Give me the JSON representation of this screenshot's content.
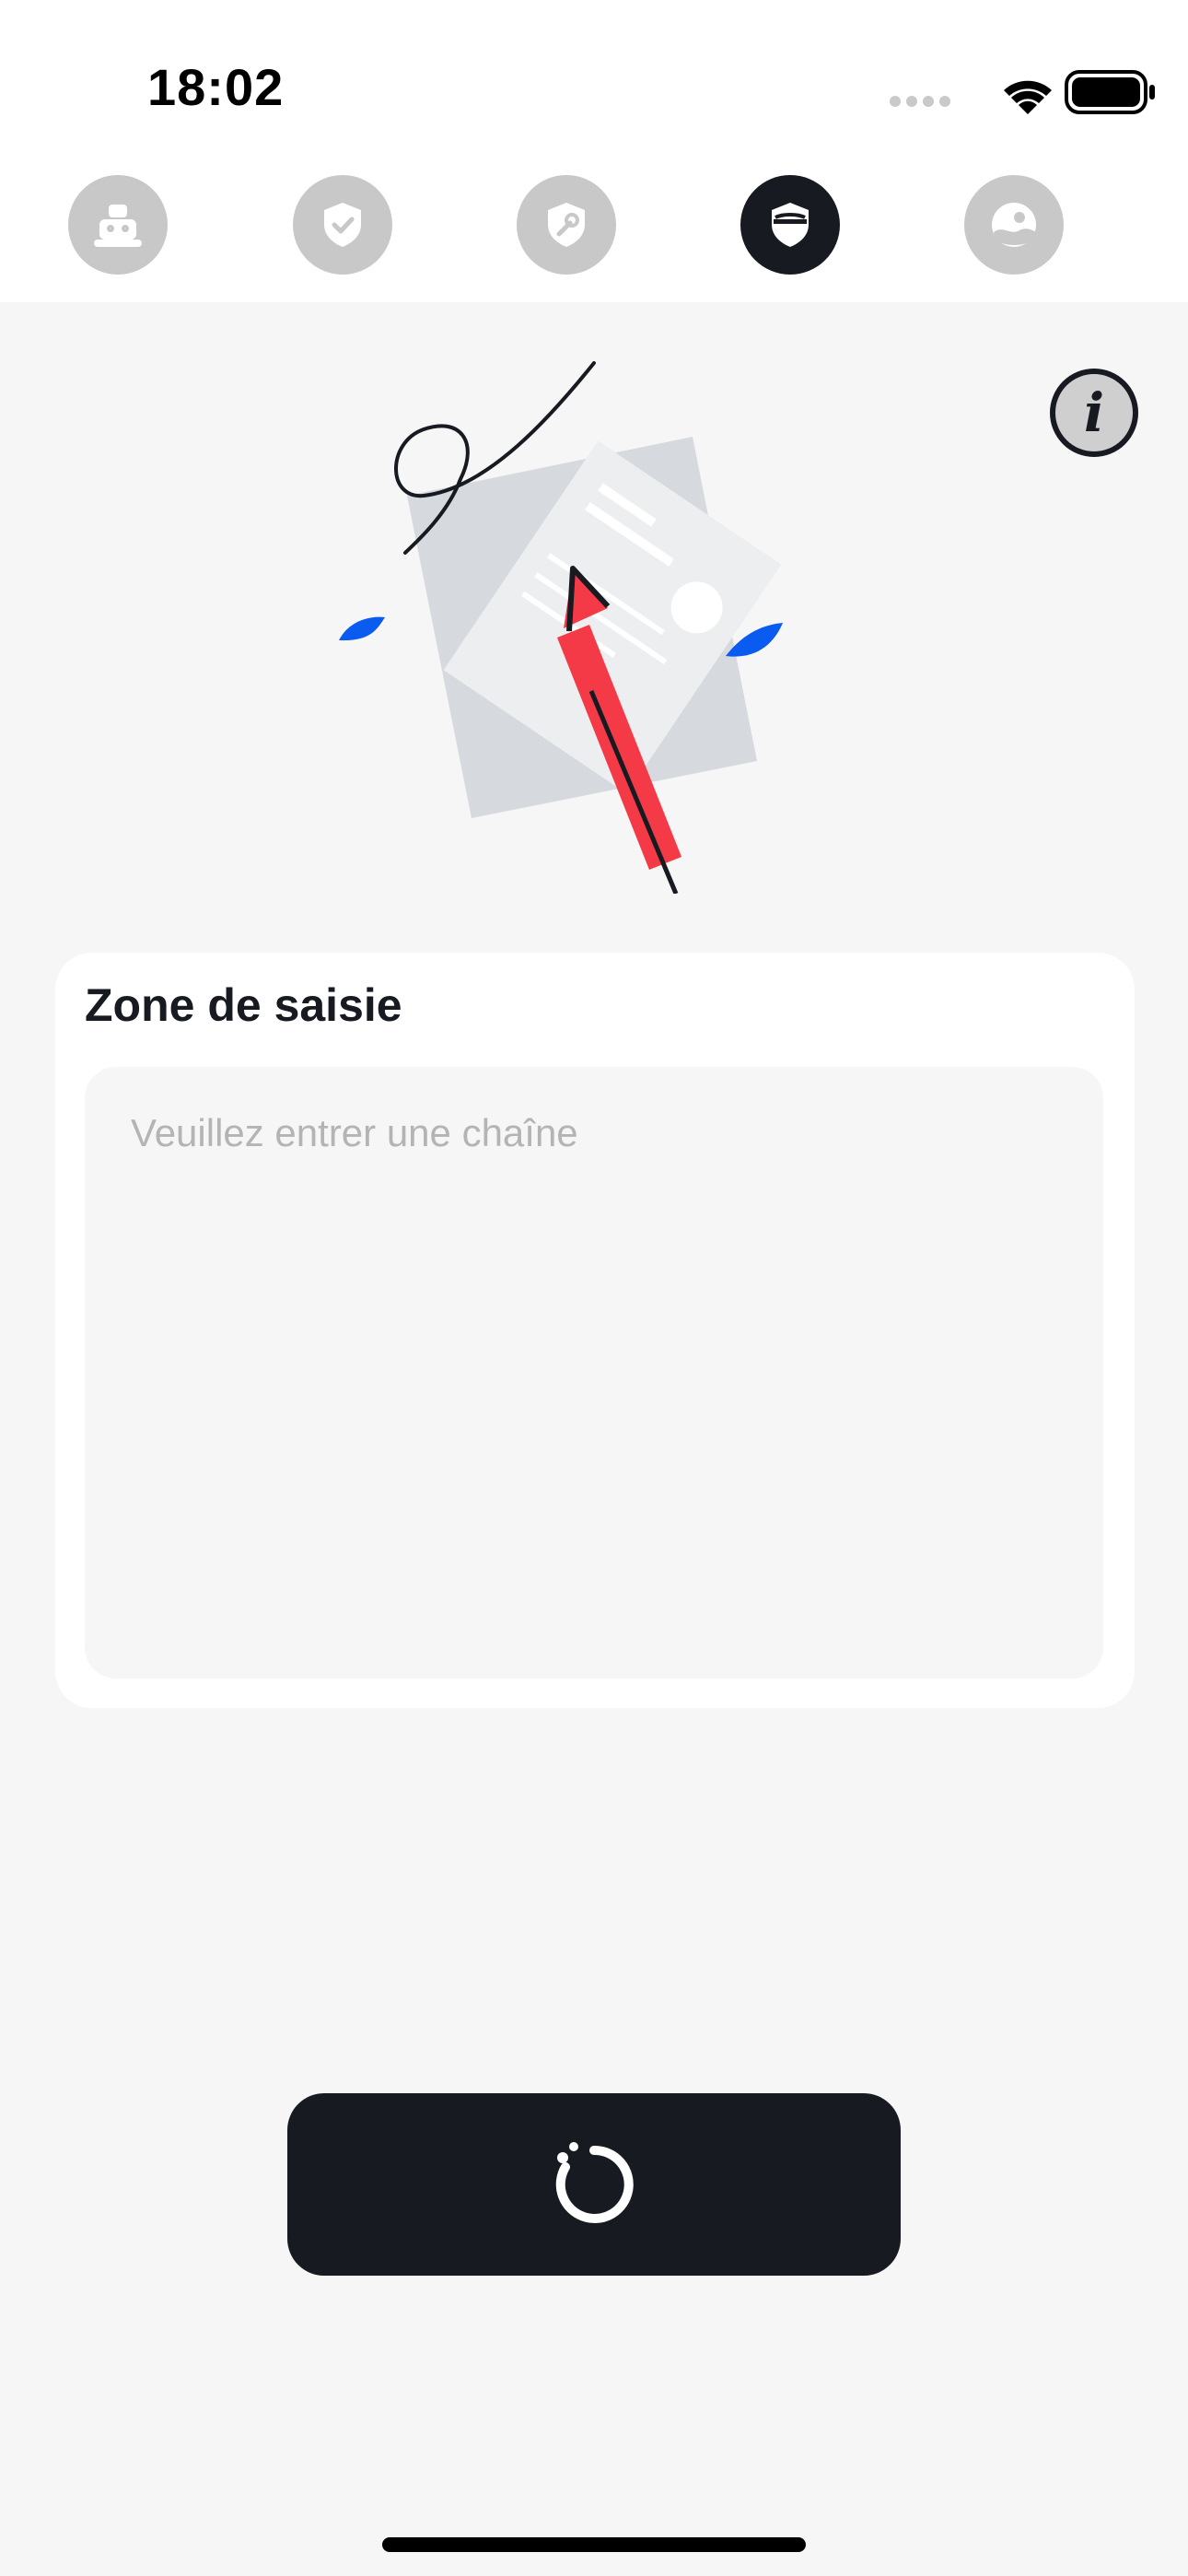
{
  "status_bar": {
    "time": "18:02"
  },
  "tabs": [
    {
      "icon": "robot-icon",
      "active": false
    },
    {
      "icon": "shield-check-icon",
      "active": false
    },
    {
      "icon": "shield-wrench-icon",
      "active": false
    },
    {
      "icon": "shield-visor-icon",
      "active": true
    },
    {
      "icon": "landscape-icon",
      "active": false
    }
  ],
  "info_button": {
    "glyph": "i"
  },
  "input_card": {
    "title": "Zone de saisie",
    "placeholder": "Veuillez entrer une chaîne",
    "value": ""
  },
  "action_button": {
    "icon": "loading-spinner-icon"
  },
  "colors": {
    "accent_dark": "#181a22",
    "tab_inactive": "#c8c8c8",
    "background": "#f6f6f6",
    "card": "#ffffff",
    "pencil_red": "#f43a47",
    "leaf_blue": "#0a5cf0"
  }
}
